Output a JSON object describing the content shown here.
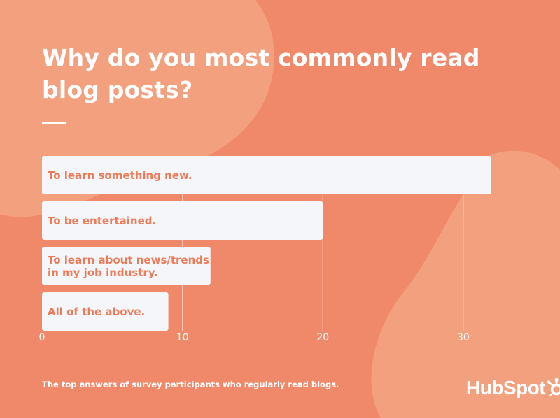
{
  "header": {
    "title": "Why do you most commonly read blog posts?"
  },
  "footer": {
    "caption": "The top answers of survey participants who regularly read blogs.",
    "logo": "HubSpot"
  },
  "colors": {
    "background": "#F0896A",
    "blob": "#F3A07F",
    "bar_fill": "#F5F6FA",
    "bar_text": "#EE7B58",
    "text": "#FFFFFF"
  },
  "chart_data": {
    "type": "bar",
    "orientation": "horizontal",
    "categories": [
      "To learn something new.",
      "To be entertained.",
      "To learn about news/trends in my job industry.",
      "All of the above."
    ],
    "category_lines": [
      [
        "To learn something new."
      ],
      [
        "To be entertained."
      ],
      [
        "To learn about news/trends",
        "in my job industry."
      ],
      [
        "All of the above."
      ]
    ],
    "values": [
      32,
      20,
      12,
      9
    ],
    "xlim": [
      0,
      32
    ],
    "xticks": [
      0,
      10,
      20,
      30
    ],
    "grid": true,
    "title": "Why do you most commonly read blog posts?",
    "xlabel": "",
    "ylabel": ""
  }
}
